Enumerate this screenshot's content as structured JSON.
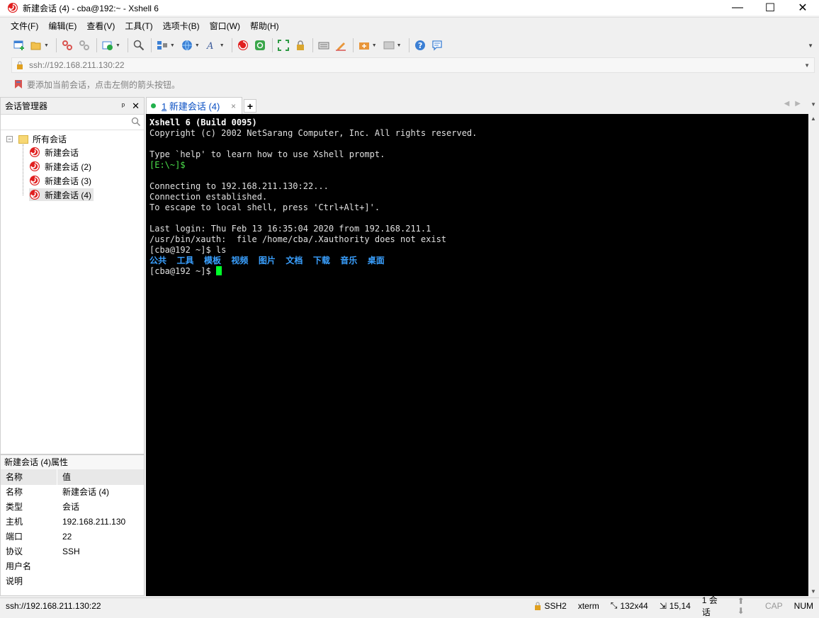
{
  "window": {
    "title": "新建会话 (4) - cba@192:~ - Xshell 6",
    "minimize": "—",
    "maximize": "☐",
    "close": "✕"
  },
  "menu": [
    "文件(F)",
    "编辑(E)",
    "查看(V)",
    "工具(T)",
    "选项卡(B)",
    "窗口(W)",
    "帮助(H)"
  ],
  "address": {
    "value": "ssh://192.168.211.130:22"
  },
  "hint": "要添加当前会话，点击左侧的箭头按钮。",
  "session_manager": {
    "title": "会话管理器",
    "pin": "ᵖ",
    "close": "✕",
    "root": "所有会话",
    "expander": "−",
    "items": [
      "新建会话",
      "新建会话 (2)",
      "新建会话 (3)",
      "新建会话 (4)"
    ]
  },
  "properties": {
    "title": "新建会话 (4)属性",
    "col_name": "名称",
    "col_value": "值",
    "rows": [
      {
        "k": "名称",
        "v": "新建会话 (4)"
      },
      {
        "k": "类型",
        "v": "会话"
      },
      {
        "k": "主机",
        "v": "192.168.211.130"
      },
      {
        "k": "端口",
        "v": "22"
      },
      {
        "k": "协议",
        "v": "SSH"
      },
      {
        "k": "用户名",
        "v": ""
      },
      {
        "k": "说明",
        "v": ""
      }
    ]
  },
  "tab": {
    "number": "1",
    "label": " 新建会话 (4)",
    "close": "×",
    "add": "+"
  },
  "terminal": {
    "header": "Xshell 6 (Build 0095)",
    "copyright": "Copyright (c) 2002 NetSarang Computer, Inc. All rights reserved.",
    "help": "Type `help' to learn how to use Xshell prompt.",
    "local_prompt": "[E:\\~]$",
    "connecting": "Connecting to 192.168.211.130:22...",
    "established": "Connection established.",
    "escape": "To escape to local shell, press 'Ctrl+Alt+]'.",
    "last_login": "Last login: Thu Feb 13 16:35:04 2020 from 192.168.211.1",
    "xauth": "/usr/bin/xauth:  file /home/cba/.Xauthority does not exist",
    "cmd": "[cba@192 ~]$ ls",
    "dirs": [
      "公共",
      "工具",
      "模板",
      "视频",
      "图片",
      "文档",
      "下载",
      "音乐",
      "桌面"
    ],
    "prompt": "[cba@192 ~]$ "
  },
  "status": {
    "address": "ssh://192.168.211.130:22",
    "protocol": "SSH2",
    "term": "xterm",
    "size": "132x44",
    "pos": "15,14",
    "sessions": "1 会话",
    "cap": "CAP",
    "num": "NUM"
  },
  "colors": {
    "terminal_bg": "#000000",
    "prompt_green": "#4ce24c",
    "dir_blue": "#3aa0ff",
    "cursor": "#00ff2a",
    "tab_text": "#0b50c3"
  }
}
